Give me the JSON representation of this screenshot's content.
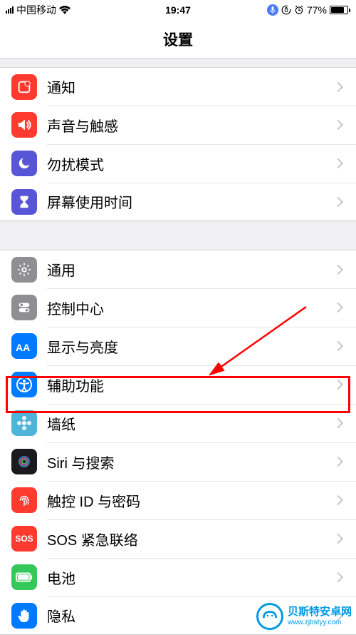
{
  "statusBar": {
    "carrier": "中国移动",
    "time": "19:47",
    "batteryPercent": "77%"
  },
  "header": {
    "title": "设置"
  },
  "groups": [
    {
      "items": [
        {
          "key": "notifications",
          "label": "通知",
          "iconColor": "#ff3b30",
          "iconName": "notifications-icon"
        },
        {
          "key": "sounds",
          "label": "声音与触感",
          "iconColor": "#ff3b30",
          "iconName": "sounds-icon"
        },
        {
          "key": "dnd",
          "label": "勿扰模式",
          "iconColor": "#5856d6",
          "iconName": "moon-icon"
        },
        {
          "key": "screentime",
          "label": "屏幕使用时间",
          "iconColor": "#5856d6",
          "iconName": "hourglass-icon"
        }
      ]
    },
    {
      "items": [
        {
          "key": "general",
          "label": "通用",
          "iconColor": "#8e8e93",
          "iconName": "gear-icon"
        },
        {
          "key": "controlcenter",
          "label": "控制中心",
          "iconColor": "#8e8e93",
          "iconName": "switches-icon"
        },
        {
          "key": "display",
          "label": "显示与亮度",
          "iconColor": "#007aff",
          "iconName": "text-size-icon"
        },
        {
          "key": "accessibility",
          "label": "辅助功能",
          "iconColor": "#007aff",
          "iconName": "accessibility-icon",
          "highlighted": true
        },
        {
          "key": "wallpaper",
          "label": "墙纸",
          "iconColor": "#50b4d8",
          "iconName": "flower-icon"
        },
        {
          "key": "siri",
          "label": "Siri 与搜索",
          "iconColor": "#1b1b1f",
          "iconName": "siri-icon"
        },
        {
          "key": "touchid",
          "label": "触控 ID 与密码",
          "iconColor": "#ff3b30",
          "iconName": "fingerprint-icon"
        },
        {
          "key": "sos",
          "label": "SOS 紧急联络",
          "iconColor": "#ff3b30",
          "iconName": "sos-icon",
          "textIcon": "SOS"
        },
        {
          "key": "battery",
          "label": "电池",
          "iconColor": "#34c759",
          "iconName": "battery-icon"
        },
        {
          "key": "privacy",
          "label": "隐私",
          "iconColor": "#007aff",
          "iconName": "hand-icon"
        }
      ]
    }
  ],
  "watermark": {
    "brand": "贝斯特安卓网",
    "url": "www.zjbstyy.com"
  }
}
